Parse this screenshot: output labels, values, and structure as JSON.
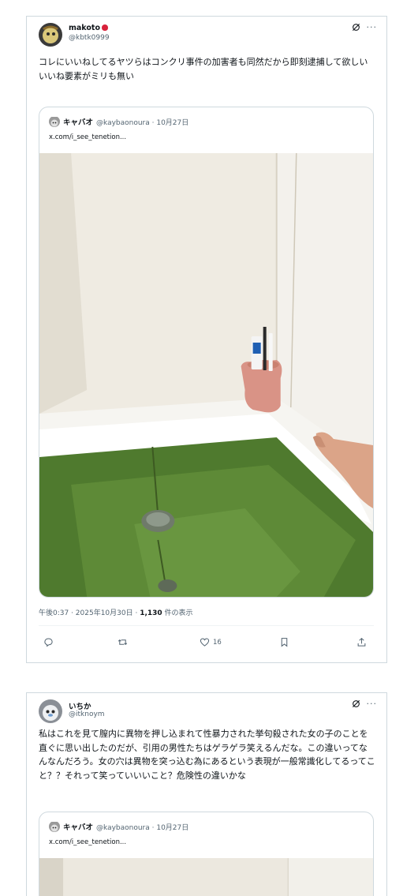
{
  "tweet1": {
    "author_name": "makoto",
    "author_handle": "@kbtk0999",
    "more_label": "···",
    "text": "コレにいいねしてるヤツらはコンクリ事件の加害者も同然だから即刻逮捕して欲しい\nいいね要素がミリも無い",
    "quote": {
      "name": "キャバオ",
      "handle_date": "@kaybaonoura · 10月27日",
      "link": "x.com/i_see_tenetion..."
    },
    "meta_time": "午後0:37 · 2025年10月30日 · ",
    "meta_views_count": "1,130",
    "meta_views_label": " 件の表示",
    "likes_count": "16"
  },
  "tweet2": {
    "author_name": "いちか",
    "author_handle": "@itknoym",
    "more_label": "···",
    "text": "私はこれを見て膣内に異物を押し込まれて性暴力された挙句殺された女の子のことを直ぐに思い出したのだが、引用の男性たちはゲラゲラ笑えるんだな。この違いってなんなんだろう。女の穴は異物を突っ込む為にあるという表現が一般常識化してるってこと？？それって笑っていいいこと？危険性の違いかな",
    "quote": {
      "name": "キャバオ",
      "handle_date": "@kaybaonoura · 10月27日",
      "link": "x.com/i_see_tenetion..."
    }
  },
  "icons": {
    "author_badge": "strawberry-emoji",
    "grok": "grok-icon",
    "reply": "reply-icon",
    "retweet": "retweet-icon",
    "like": "heart-icon",
    "bookmark": "bookmark-icon",
    "share": "share-icon"
  },
  "colors": {
    "border": "#cfd9de",
    "secondary_text": "#536471",
    "primary_text": "#0f1419",
    "bath_water": "#4f7a2e"
  }
}
